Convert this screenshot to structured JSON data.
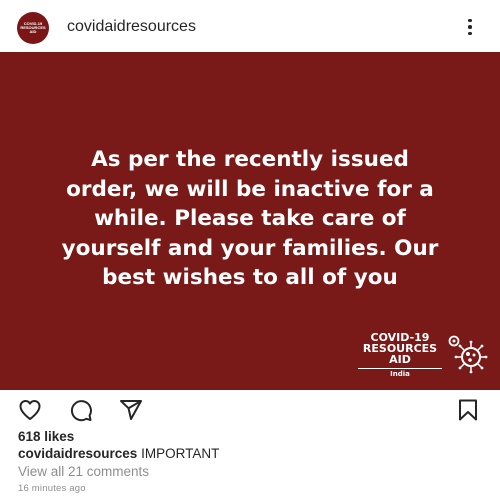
{
  "header": {
    "username": "covidaidresources",
    "avatar_text": "COVID-19 RESOURCES AID"
  },
  "post": {
    "background_color": "#7a1a18",
    "message": "As per the recently issued\norder, we will be inactive for a\nwhile. Please take care of\nyourself and your families. Our\nbest wishes to all of you",
    "logo_line1": "COVID-19",
    "logo_line2": "RESOURCES",
    "logo_line3": "AID",
    "logo_country": "India"
  },
  "actions": {
    "like_icon": "heart-icon",
    "comment_icon": "comment-icon",
    "share_icon": "share-icon",
    "save_icon": "bookmark-icon"
  },
  "likes": "618 likes",
  "caption": {
    "username": "covidaidresources",
    "text": "IMPORTANT"
  },
  "comments_link": "View all 21 comments",
  "timestamp": "16 minutes ago"
}
